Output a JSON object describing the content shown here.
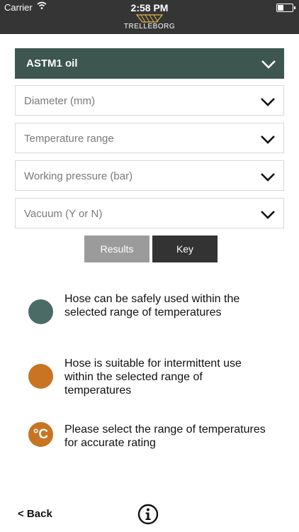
{
  "status_bar": {
    "carrier": "Carrier",
    "time": "2:58 PM"
  },
  "header": {
    "brand": "TRELLEBORG"
  },
  "dropdowns": {
    "main": "ASTM1 oil",
    "diameter": "Diameter (mm)",
    "temperature": "Temperature range",
    "pressure": "Working pressure (bar)",
    "vacuum": "Vacuum (Y or N)"
  },
  "buttons": {
    "results": "Results",
    "key": "Key"
  },
  "legend": [
    {
      "color": "#4b6b67",
      "text": "Hose can be safely used within the selected range of temperatures"
    },
    {
      "color": "#c87422",
      "text": "Hose is suitable for intermittent use within the selected range of temperatures"
    },
    {
      "color": "#c87422",
      "symbol": "°C",
      "text": "Please select the range of temperatures for accurate rating"
    }
  ],
  "footer": {
    "back": "< Back"
  },
  "colors": {
    "header_bg": "#353535",
    "main_dropdown_bg": "#3d564f",
    "safe": "#4b6b67",
    "intermittent": "#c87422"
  }
}
